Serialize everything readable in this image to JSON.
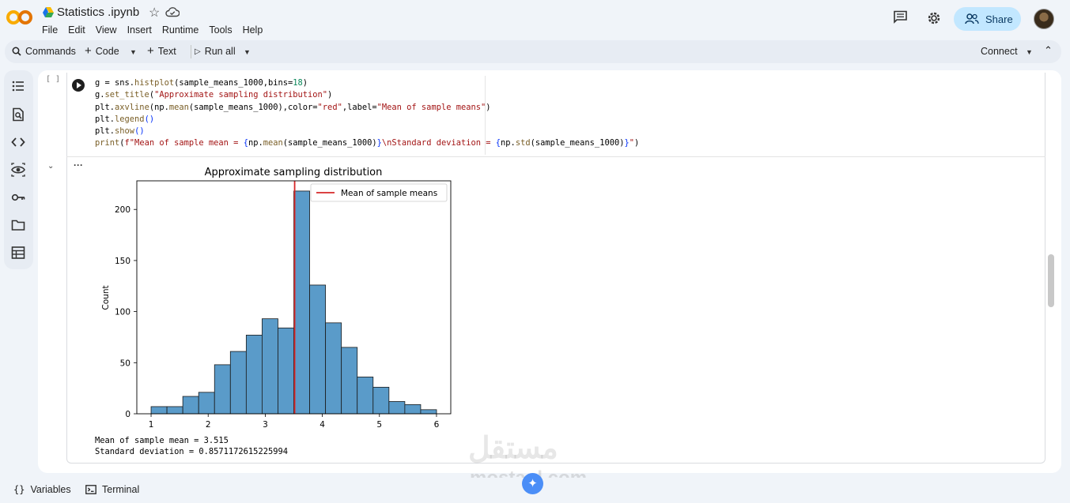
{
  "app": {
    "logo": "CO",
    "file_title": "Statistics .ipynb",
    "menus": [
      "File",
      "Edit",
      "View",
      "Insert",
      "Runtime",
      "Tools",
      "Help"
    ],
    "share_label": "Share"
  },
  "toolbar": {
    "commands_label": "Commands",
    "code_label": "Code",
    "text_label": "Text",
    "run_all_label": "Run all",
    "connect_label": "Connect"
  },
  "cell": {
    "bracket": "[ ]",
    "code_lines": [
      "g = sns.histplot(sample_means_1000,bins=18)",
      "g.set_title(\"Approximate sampling distribution\")",
      "plt.axvline(np.mean(sample_means_1000),color=\"red\",label=\"Mean of sample means\")",
      "plt.legend()",
      "plt.show()",
      "print(f\"Mean of sample mean = {np.mean(sample_means_1000)}\\nStandard deviation = {np.std(sample_means_1000)}\")"
    ],
    "output_text": [
      "Mean of sample mean = 3.515",
      "Standard deviation = 0.8571172615225994"
    ]
  },
  "chart_data": {
    "type": "bar",
    "title": "Approximate sampling distribution",
    "xlabel": "",
    "ylabel": "Count",
    "xlim": [
      0.75,
      6.25
    ],
    "ylim": [
      0,
      228
    ],
    "x_ticks": [
      1,
      2,
      3,
      4,
      5,
      6
    ],
    "y_ticks": [
      0,
      50,
      100,
      150,
      200
    ],
    "bin_start": 1.0,
    "bin_width": 0.2778,
    "values": [
      7,
      7,
      17,
      21,
      48,
      61,
      77,
      93,
      84,
      218,
      126,
      89,
      65,
      36,
      26,
      12,
      9,
      4
    ],
    "vline": {
      "x": 3.515,
      "label": "Mean of sample means",
      "color": "#d62728"
    },
    "bar_color": "#5a9bc9",
    "legend_placement": "top-right"
  },
  "statusbar": {
    "variables_label": "Variables",
    "terminal_label": "Terminal"
  },
  "watermark": {
    "arabic": "مستقل",
    "latin": "mostaql.com"
  }
}
